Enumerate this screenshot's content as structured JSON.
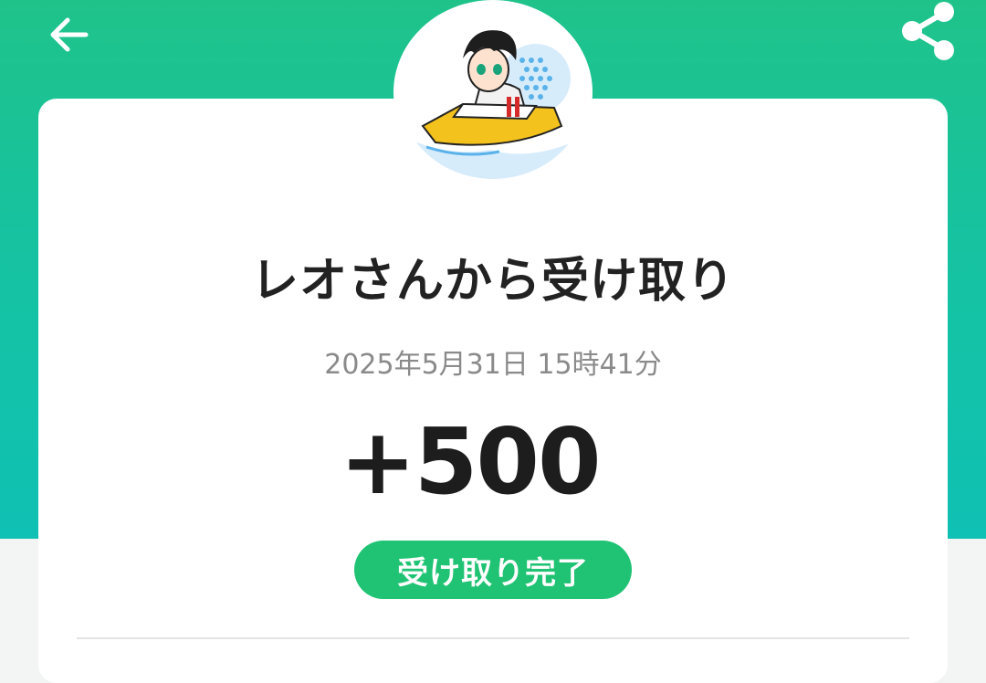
{
  "header": {
    "back_icon": "arrow-left-icon",
    "share_icon": "share-icon",
    "accent_colors": [
      "#1fc38a",
      "#0fc1b4"
    ]
  },
  "avatar": {
    "description_icon": "user-avatar-boat-icon"
  },
  "transaction": {
    "title": "レオさんから受け取り",
    "datetime": "2025年5月31日 15時41分",
    "amount": "+500",
    "status": "受け取り完了",
    "status_color": "#1fc373"
  }
}
